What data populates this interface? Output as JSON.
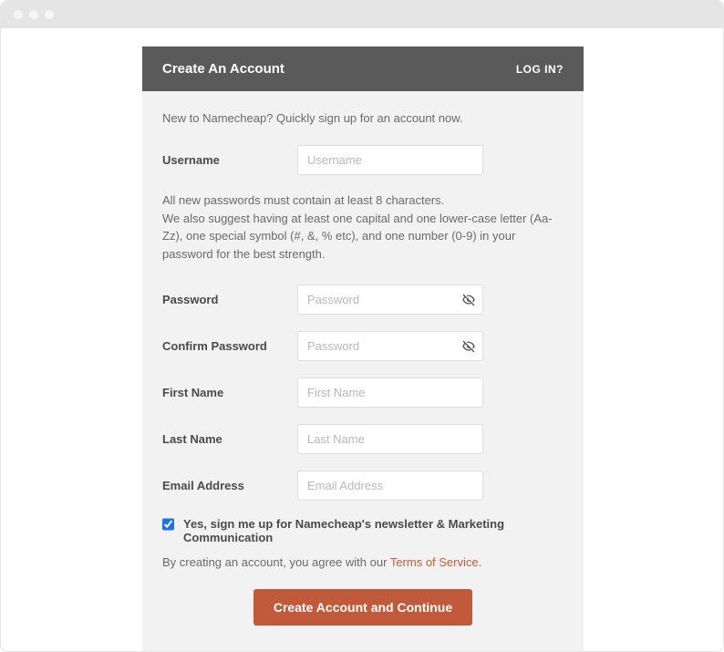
{
  "header": {
    "title": "Create An Account",
    "login_label": "LOG IN?"
  },
  "intro": "New to Namecheap? Quickly sign up for an account now.",
  "fields": {
    "username": {
      "label": "Username",
      "placeholder": "Username",
      "value": ""
    },
    "password": {
      "label": "Password",
      "placeholder": "Password",
      "value": ""
    },
    "confirm_password": {
      "label": "Confirm Password",
      "placeholder": "Password",
      "value": ""
    },
    "first_name": {
      "label": "First Name",
      "placeholder": "First Name",
      "value": ""
    },
    "last_name": {
      "label": "Last Name",
      "placeholder": "Last Name",
      "value": ""
    },
    "email": {
      "label": "Email Address",
      "placeholder": "Email Address",
      "value": ""
    }
  },
  "password_hint_line1": "All new passwords must contain at least 8 characters.",
  "password_hint_line2": "We also suggest having at least one capital and one lower-case letter (Aa-Zz), one special symbol (#, &, % etc), and one number (0-9) in your password for the best strength.",
  "newsletter": {
    "checked": true,
    "label": "Yes, sign me up for Namecheap's newsletter & Marketing Communication"
  },
  "tos": {
    "prefix": "By creating an account, you agree with our ",
    "link_text": "Terms of Service",
    "suffix": "."
  },
  "submit_label": "Create Account and Continue"
}
